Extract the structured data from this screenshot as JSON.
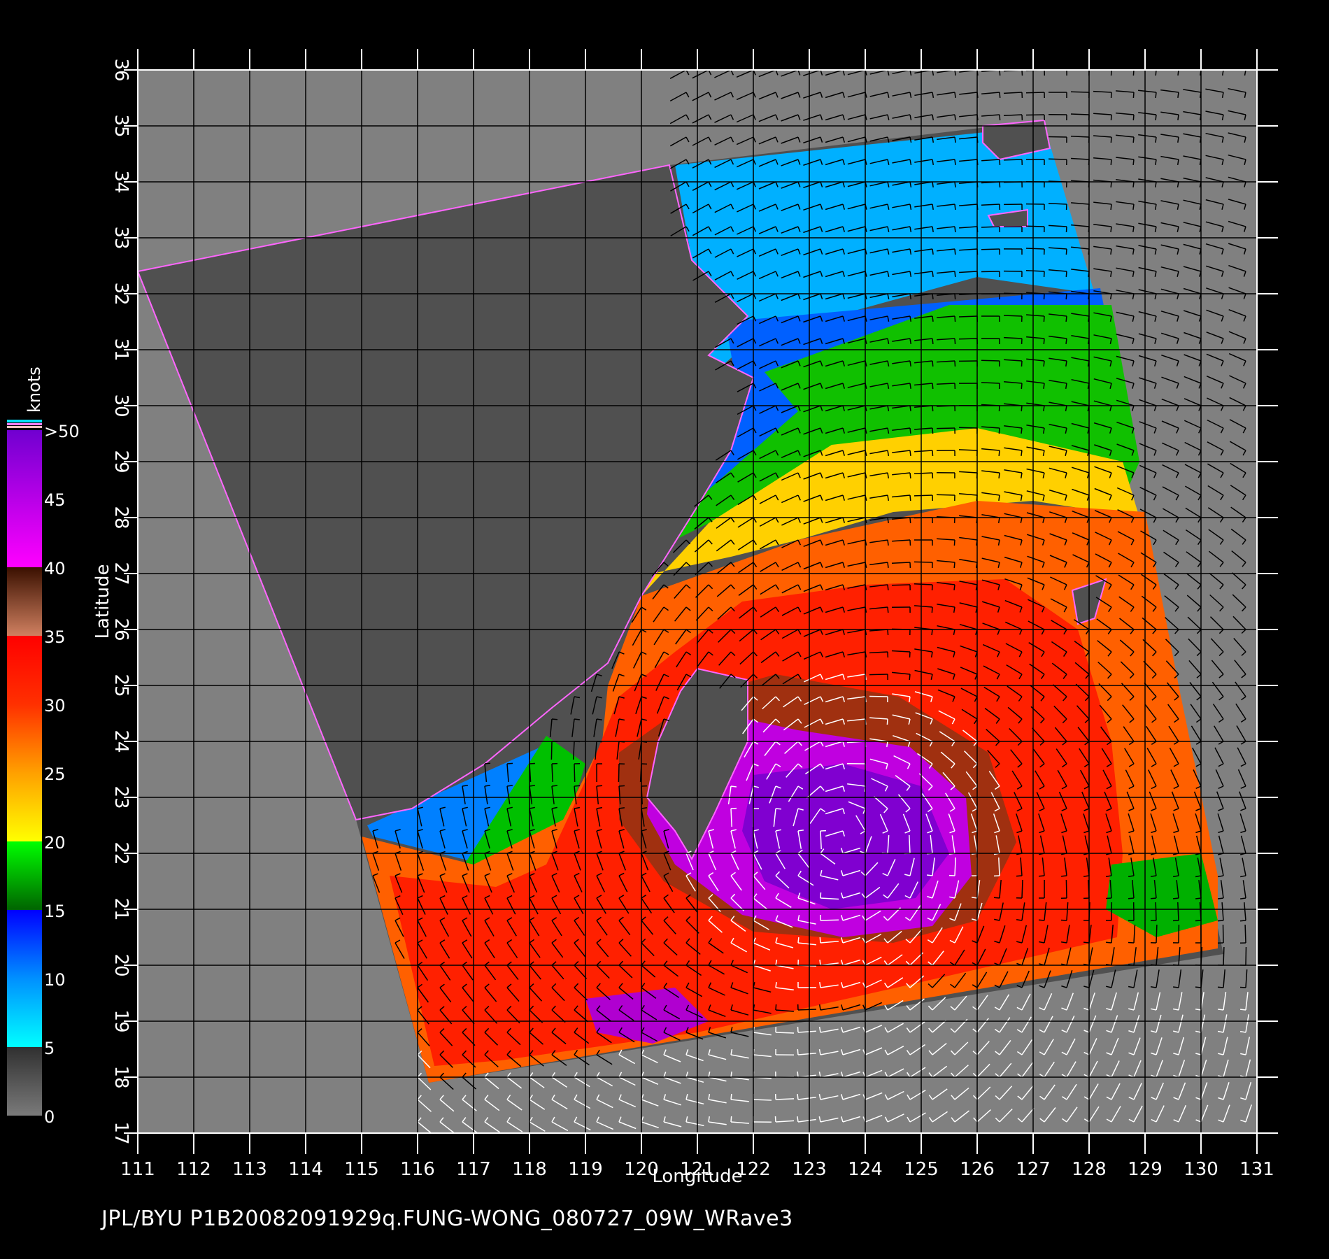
{
  "figure": {
    "credit": "JPL/BYU  P1B20082091929q.FUNG-WONG_080727_09W_WRave3"
  },
  "map": {
    "xlabel": "Longitude",
    "ylabel": "Latitude",
    "lon_range": [
      111,
      131
    ],
    "lat_range": [
      17,
      36
    ],
    "lon_ticks": [
      "111",
      "112",
      "113",
      "114",
      "115",
      "116",
      "117",
      "118",
      "119",
      "120",
      "121",
      "122",
      "123",
      "124",
      "125",
      "126",
      "127",
      "128",
      "129",
      "130",
      "131"
    ],
    "lat_ticks": [
      "17",
      "18",
      "19",
      "20",
      "21",
      "22",
      "23",
      "24",
      "25",
      "26",
      "27",
      "28",
      "29",
      "30",
      "31",
      "32",
      "33",
      "34",
      "35",
      "36"
    ],
    "grid": true,
    "colors": {
      "background": "#000000",
      "no_data": "#808080",
      "land": "#505050",
      "grid": "#000000",
      "frame": "#ffffff",
      "wind_vector_low": "#000000",
      "wind_vector_high": "#ffffff"
    },
    "swath_corners_lonlat": [
      [
        111.0,
        32.4
      ],
      [
        120.5,
        34.3
      ],
      [
        127.2,
        35.1
      ],
      [
        130.4,
        20.2
      ],
      [
        116.2,
        17.9
      ],
      [
        114.9,
        22.6
      ],
      [
        111.0,
        32.4
      ]
    ],
    "storm_center_lonlat": [
      123.6,
      22.3
    ]
  },
  "colorbar": {
    "title": "knots",
    "labels": [
      ">50",
      "45",
      "40",
      "35",
      "30",
      "25",
      "20",
      "15",
      "10",
      "5",
      "0"
    ],
    "stops": [
      {
        "value": 0,
        "color": "#7a7a7a"
      },
      {
        "value": 5,
        "color": "#303030"
      },
      {
        "value": 5,
        "color": "#00ffff"
      },
      {
        "value": 10,
        "color": "#0090ff"
      },
      {
        "value": 15,
        "color": "#0000ff"
      },
      {
        "value": 15,
        "color": "#006400"
      },
      {
        "value": 20,
        "color": "#00ff00"
      },
      {
        "value": 20,
        "color": "#ffff00"
      },
      {
        "value": 25,
        "color": "#ffa000"
      },
      {
        "value": 30,
        "color": "#ff3000"
      },
      {
        "value": 35,
        "color": "#ff0000"
      },
      {
        "value": 35,
        "color": "#d08060"
      },
      {
        "value": 40,
        "color": "#3a1000"
      },
      {
        "value": 40,
        "color": "#ff00ff"
      },
      {
        "value": 50,
        "color": "#7000d0"
      }
    ]
  },
  "wind_speed_regions": [
    {
      "name": "northern-coastal-calm",
      "color": "#00b0ff",
      "poly": [
        [
          120.6,
          34.3
        ],
        [
          127.2,
          35.0
        ],
        [
          128.1,
          32.0
        ],
        [
          126.0,
          32.3
        ],
        [
          122.0,
          31.2
        ],
        [
          121.2,
          30.5
        ],
        [
          121.6,
          29.0
        ],
        [
          120.9,
          28.6
        ],
        [
          121.2,
          30.5
        ],
        [
          120.9,
          32.6
        ]
      ]
    },
    {
      "name": "northern-blue-band",
      "color": "#0060ff",
      "poly": [
        [
          121.5,
          31.5
        ],
        [
          128.2,
          32.1
        ],
        [
          128.3,
          31.6
        ],
        [
          125.0,
          31.0
        ],
        [
          123.0,
          30.5
        ],
        [
          122.8,
          29.8
        ],
        [
          121.6,
          28.6
        ],
        [
          121.1,
          28.3
        ],
        [
          121.8,
          29.8
        ]
      ]
    },
    {
      "name": "green-band",
      "color": "#10c000",
      "poly": [
        [
          122.2,
          30.6
        ],
        [
          125.5,
          31.8
        ],
        [
          128.4,
          31.8
        ],
        [
          128.9,
          29.0
        ],
        [
          128.6,
          28.3
        ],
        [
          126.0,
          29.3
        ],
        [
          123.4,
          29.2
        ],
        [
          121.2,
          27.9
        ],
        [
          120.6,
          27.6
        ],
        [
          121.2,
          28.5
        ],
        [
          122.8,
          29.9
        ]
      ]
    },
    {
      "name": "yellow-band",
      "color": "#ffd000",
      "poly": [
        [
          121.2,
          27.9
        ],
        [
          123.4,
          29.3
        ],
        [
          126.0,
          29.6
        ],
        [
          128.6,
          29.0
        ],
        [
          128.9,
          28.0
        ],
        [
          127.0,
          28.3
        ],
        [
          124.5,
          28.1
        ],
        [
          122.8,
          27.6
        ],
        [
          121.6,
          27.3
        ],
        [
          120.2,
          27.0
        ],
        [
          120.0,
          26.6
        ]
      ]
    },
    {
      "name": "southwest-calm",
      "color": "#0080ff",
      "poly": [
        [
          115.1,
          22.5
        ],
        [
          118.2,
          23.9
        ],
        [
          118.1,
          22.6
        ],
        [
          117.2,
          21.8
        ],
        [
          115.2,
          22.3
        ]
      ]
    },
    {
      "name": "southwest-green",
      "color": "#00c000",
      "poly": [
        [
          116.9,
          21.9
        ],
        [
          118.3,
          24.1
        ],
        [
          119.0,
          23.6
        ],
        [
          118.5,
          22.0
        ],
        [
          117.5,
          21.2
        ],
        [
          116.6,
          21.5
        ]
      ]
    },
    {
      "name": "orange-outer-band",
      "color": "#ff6000",
      "poly": [
        [
          120.0,
          26.6
        ],
        [
          122.8,
          27.6
        ],
        [
          126.0,
          28.3
        ],
        [
          129.0,
          28.1
        ],
        [
          129.6,
          25.0
        ],
        [
          130.3,
          21.6
        ],
        [
          130.3,
          20.3
        ],
        [
          116.2,
          17.9
        ],
        [
          115.0,
          22.3
        ],
        [
          117.0,
          21.8
        ],
        [
          118.6,
          22.6
        ],
        [
          119.3,
          24.0
        ],
        [
          119.4,
          25.0
        ]
      ]
    },
    {
      "name": "red-band",
      "color": "#ff2000",
      "poly": [
        [
          121.8,
          26.5
        ],
        [
          124.0,
          26.8
        ],
        [
          126.5,
          26.9
        ],
        [
          127.8,
          26.0
        ],
        [
          128.4,
          24.0
        ],
        [
          128.6,
          22.0
        ],
        [
          128.5,
          20.5
        ],
        [
          125.0,
          19.7
        ],
        [
          121.0,
          18.8
        ],
        [
          117.5,
          18.3
        ],
        [
          116.3,
          18.2
        ],
        [
          115.5,
          21.6
        ],
        [
          117.4,
          21.4
        ],
        [
          118.3,
          21.8
        ],
        [
          119.0,
          23.3
        ],
        [
          119.6,
          24.8
        ],
        [
          120.6,
          25.6
        ]
      ]
    },
    {
      "name": "brown-eyewall",
      "color": "#a03010",
      "poly": [
        [
          119.6,
          23.8
        ],
        [
          121.0,
          24.8
        ],
        [
          122.4,
          25.2
        ],
        [
          124.6,
          24.8
        ],
        [
          126.2,
          23.8
        ],
        [
          126.7,
          22.2
        ],
        [
          126.0,
          20.8
        ],
        [
          124.5,
          20.4
        ],
        [
          122.0,
          20.6
        ],
        [
          120.4,
          21.5
        ],
        [
          119.6,
          22.6
        ]
      ]
    },
    {
      "name": "magenta-core",
      "color": "#c000e0",
      "poly": [
        [
          120.2,
          23.6
        ],
        [
          121.4,
          24.5
        ],
        [
          122.8,
          24.2
        ],
        [
          124.8,
          23.9
        ],
        [
          125.8,
          23.0
        ],
        [
          125.9,
          21.6
        ],
        [
          125.2,
          20.7
        ],
        [
          123.6,
          20.5
        ],
        [
          121.8,
          20.9
        ],
        [
          120.6,
          21.8
        ],
        [
          120.1,
          22.7
        ]
      ]
    },
    {
      "name": "purple-core",
      "color": "#8000d0",
      "poly": [
        [
          122.0,
          23.4
        ],
        [
          123.6,
          23.6
        ],
        [
          125.0,
          23.2
        ],
        [
          125.5,
          22.0
        ],
        [
          124.9,
          21.2
        ],
        [
          123.4,
          21.0
        ],
        [
          122.2,
          21.5
        ],
        [
          121.8,
          22.4
        ]
      ]
    },
    {
      "name": "south-magenta-patch",
      "color": "#b000d0",
      "poly": [
        [
          119.0,
          19.4
        ],
        [
          120.6,
          19.6
        ],
        [
          121.2,
          19.0
        ],
        [
          120.2,
          18.6
        ],
        [
          119.2,
          18.8
        ]
      ]
    },
    {
      "name": "east-green-patch",
      "color": "#00b000",
      "poly": [
        [
          128.4,
          21.8
        ],
        [
          130.0,
          22.0
        ],
        [
          130.3,
          20.8
        ],
        [
          129.2,
          20.5
        ],
        [
          128.3,
          21.0
        ]
      ]
    }
  ],
  "land_regions": [
    {
      "name": "mainland-china",
      "poly": [
        [
          111.0,
          32.4
        ],
        [
          120.5,
          34.3
        ],
        [
          120.9,
          32.6
        ],
        [
          121.9,
          31.6
        ],
        [
          121.2,
          30.9
        ],
        [
          122.0,
          30.5
        ],
        [
          121.6,
          29.2
        ],
        [
          121.0,
          28.2
        ],
        [
          120.0,
          26.6
        ],
        [
          119.4,
          25.4
        ],
        [
          118.4,
          24.6
        ],
        [
          117.2,
          23.6
        ],
        [
          115.9,
          22.8
        ],
        [
          114.9,
          22.6
        ]
      ]
    },
    {
      "name": "taiwan",
      "poly": [
        [
          121.0,
          25.3
        ],
        [
          121.9,
          25.1
        ],
        [
          121.9,
          24.0
        ],
        [
          121.3,
          22.7
        ],
        [
          120.9,
          21.9
        ],
        [
          120.6,
          22.4
        ],
        [
          120.1,
          23.0
        ],
        [
          120.3,
          24.0
        ],
        [
          120.7,
          24.9
        ]
      ]
    },
    {
      "name": "korea-coast",
      "poly": [
        [
          126.1,
          35.0
        ],
        [
          127.2,
          35.1
        ],
        [
          127.3,
          34.6
        ],
        [
          126.4,
          34.4
        ],
        [
          126.1,
          34.7
        ]
      ]
    },
    {
      "name": "jeju",
      "poly": [
        [
          126.2,
          33.4
        ],
        [
          126.9,
          33.5
        ],
        [
          126.9,
          33.2
        ],
        [
          126.3,
          33.2
        ]
      ]
    },
    {
      "name": "okinawa",
      "poly": [
        [
          127.7,
          26.7
        ],
        [
          128.3,
          26.9
        ],
        [
          128.1,
          26.2
        ],
        [
          127.8,
          26.1
        ]
      ]
    }
  ],
  "wind_field": {
    "storm_center": [
      123.6,
      22.3
    ],
    "grid_step_deg": 0.4,
    "high_speed_threshold": 40
  }
}
